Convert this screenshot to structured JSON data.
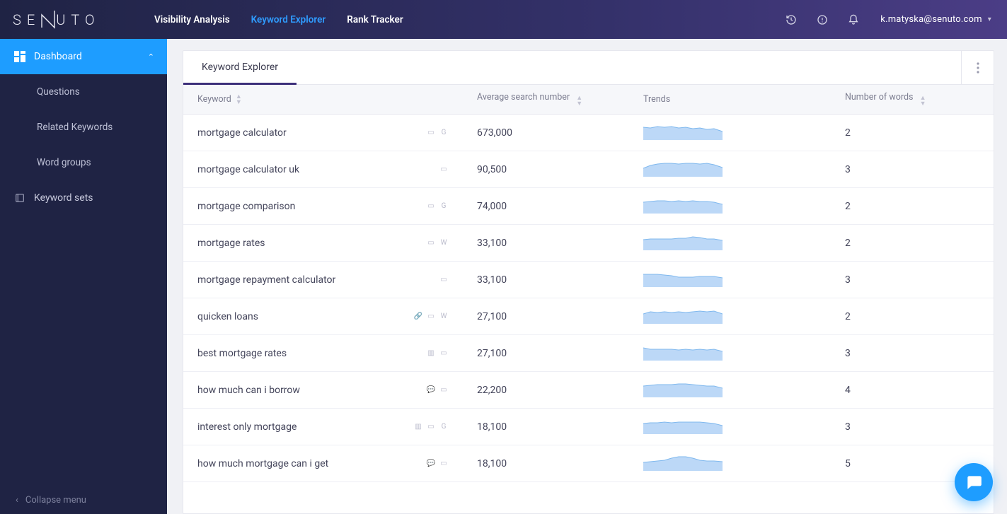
{
  "brand": "SENUTO",
  "nav": {
    "items": [
      "Visibility Analysis",
      "Keyword Explorer",
      "Rank Tracker"
    ],
    "active_index": 1
  },
  "user_email": "k.matyska@senuto.com",
  "sidebar": {
    "dashboard": "Dashboard",
    "items": [
      "Questions",
      "Related Keywords",
      "Word groups"
    ],
    "sets": "Keyword sets",
    "collapse": "Collapse menu"
  },
  "panel": {
    "tab": "Keyword Explorer",
    "columns": {
      "keyword": "Keyword",
      "search": "Average search number",
      "trends": "Trends",
      "words": "Number of words"
    }
  },
  "rows": [
    {
      "keyword": "mortgage calculator",
      "search": "673,000",
      "words": "2",
      "icons": [
        "snippet",
        "google"
      ]
    },
    {
      "keyword": "mortgage calculator uk",
      "search": "90,500",
      "words": "3",
      "icons": [
        "snippet"
      ]
    },
    {
      "keyword": "mortgage comparison",
      "search": "74,000",
      "words": "2",
      "icons": [
        "snippet",
        "google"
      ]
    },
    {
      "keyword": "mortgage rates",
      "search": "33,100",
      "words": "2",
      "icons": [
        "snippet",
        "wiki"
      ]
    },
    {
      "keyword": "mortgage repayment calculator",
      "search": "33,100",
      "words": "3",
      "icons": [
        "snippet"
      ]
    },
    {
      "keyword": "quicken loans",
      "search": "27,100",
      "words": "2",
      "icons": [
        "link",
        "snippet",
        "wiki"
      ]
    },
    {
      "keyword": "best mortgage rates",
      "search": "27,100",
      "words": "3",
      "icons": [
        "card",
        "snippet"
      ]
    },
    {
      "keyword": "how much can i borrow",
      "search": "22,200",
      "words": "4",
      "icons": [
        "qa",
        "snippet"
      ]
    },
    {
      "keyword": "interest only mortgage",
      "search": "18,100",
      "words": "3",
      "icons": [
        "card",
        "snippet",
        "google"
      ]
    },
    {
      "keyword": "how much mortgage can i get",
      "search": "18,100",
      "words": "5",
      "icons": [
        "qa",
        "snippet"
      ]
    }
  ],
  "icon_glyphs": {
    "snippet": "▭",
    "google": "G",
    "wiki": "W",
    "link": "🔗",
    "card": "▥",
    "qa": "💬"
  },
  "sparkline_variants": [
    "0,6 10,7 20,5 30,6 40,5 50,7 60,6 70,8 80,7 90,9 100,8 112,12",
    "0,12 10,8 20,6 30,5 40,5 50,6 60,5 70,5 80,6 90,5 100,7 112,11",
    "0,8 10,7 20,6 30,6 40,7 50,6 60,7 70,6 80,7 90,7 100,8 112,11",
    "0,9 10,8 20,8 30,8 40,8 50,7 60,7 70,5 80,6 90,8 100,8 112,10",
    "0,6 10,6 20,6 30,7 40,8 50,10 60,10 70,10 80,9 90,9 100,9 112,11",
    "0,10 10,7 20,8 30,7 40,8 50,7 60,8 70,7 80,6 90,7 100,6 112,10",
    "0,6 10,8 20,8 30,8 40,8 50,9 60,8 70,9 80,8 90,9 100,8 112,11",
    "0,8 10,7 20,6 30,6 40,6 50,5 60,5 70,6 80,7 90,8 100,8 112,11",
    "0,9 10,8 20,8 30,7 40,8 50,7 60,7 70,7 80,7 90,8 100,9 112,12",
    "0,12 10,11 20,10 30,9 40,6 50,4 60,4 70,6 80,9 90,10 100,10 112,11"
  ]
}
